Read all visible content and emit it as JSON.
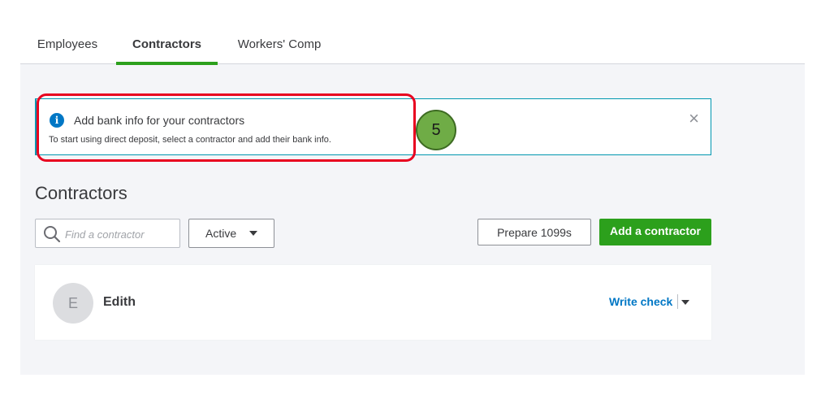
{
  "tabs": [
    {
      "label": "Employees"
    },
    {
      "label": "Contractors"
    },
    {
      "label": "Workers' Comp"
    }
  ],
  "banner": {
    "title": "Add bank info for your contractors",
    "body": "To start using direct deposit, select a contractor and add their bank info.",
    "close_glyph": "×",
    "info_glyph": "i"
  },
  "annotation": {
    "number": "5"
  },
  "page": {
    "title": "Contractors"
  },
  "search": {
    "placeholder": "Find a contractor",
    "value": ""
  },
  "filter": {
    "selected": "Active"
  },
  "buttons": {
    "prepare_1099": "Prepare 1099s",
    "add_contractor": "Add a contractor"
  },
  "contractors": [
    {
      "initial": "E",
      "name": "Edith",
      "action": "Write check"
    }
  ],
  "colors": {
    "accent_green": "#2ca01c",
    "link_blue": "#0077c5",
    "banner_border": "#0097b0",
    "annotation_red": "#e8001f",
    "annotation_circle": "#6fac46"
  }
}
